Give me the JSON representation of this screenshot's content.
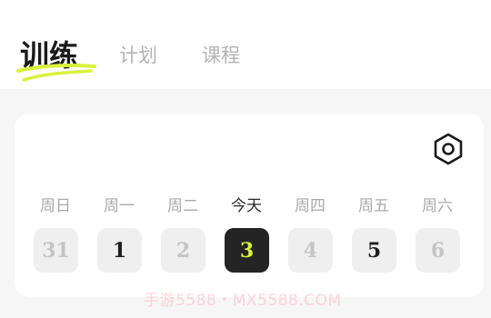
{
  "tabs": {
    "train": "训练",
    "plan": "计划",
    "course": "课程"
  },
  "accent_color": "#d8f23a",
  "settings_icon": "settings-hex-icon",
  "week": [
    {
      "weekday": "周日",
      "date": "31",
      "trained": false,
      "today": false
    },
    {
      "weekday": "周一",
      "date": "1",
      "trained": true,
      "today": false
    },
    {
      "weekday": "周二",
      "date": "2",
      "trained": false,
      "today": false
    },
    {
      "weekday": "今天",
      "date": "3",
      "trained": false,
      "today": true
    },
    {
      "weekday": "周四",
      "date": "4",
      "trained": false,
      "today": false
    },
    {
      "weekday": "周五",
      "date": "5",
      "trained": true,
      "today": false
    },
    {
      "weekday": "周六",
      "date": "6",
      "trained": false,
      "today": false
    }
  ],
  "watermark": "手游5588・MX5588.COM"
}
